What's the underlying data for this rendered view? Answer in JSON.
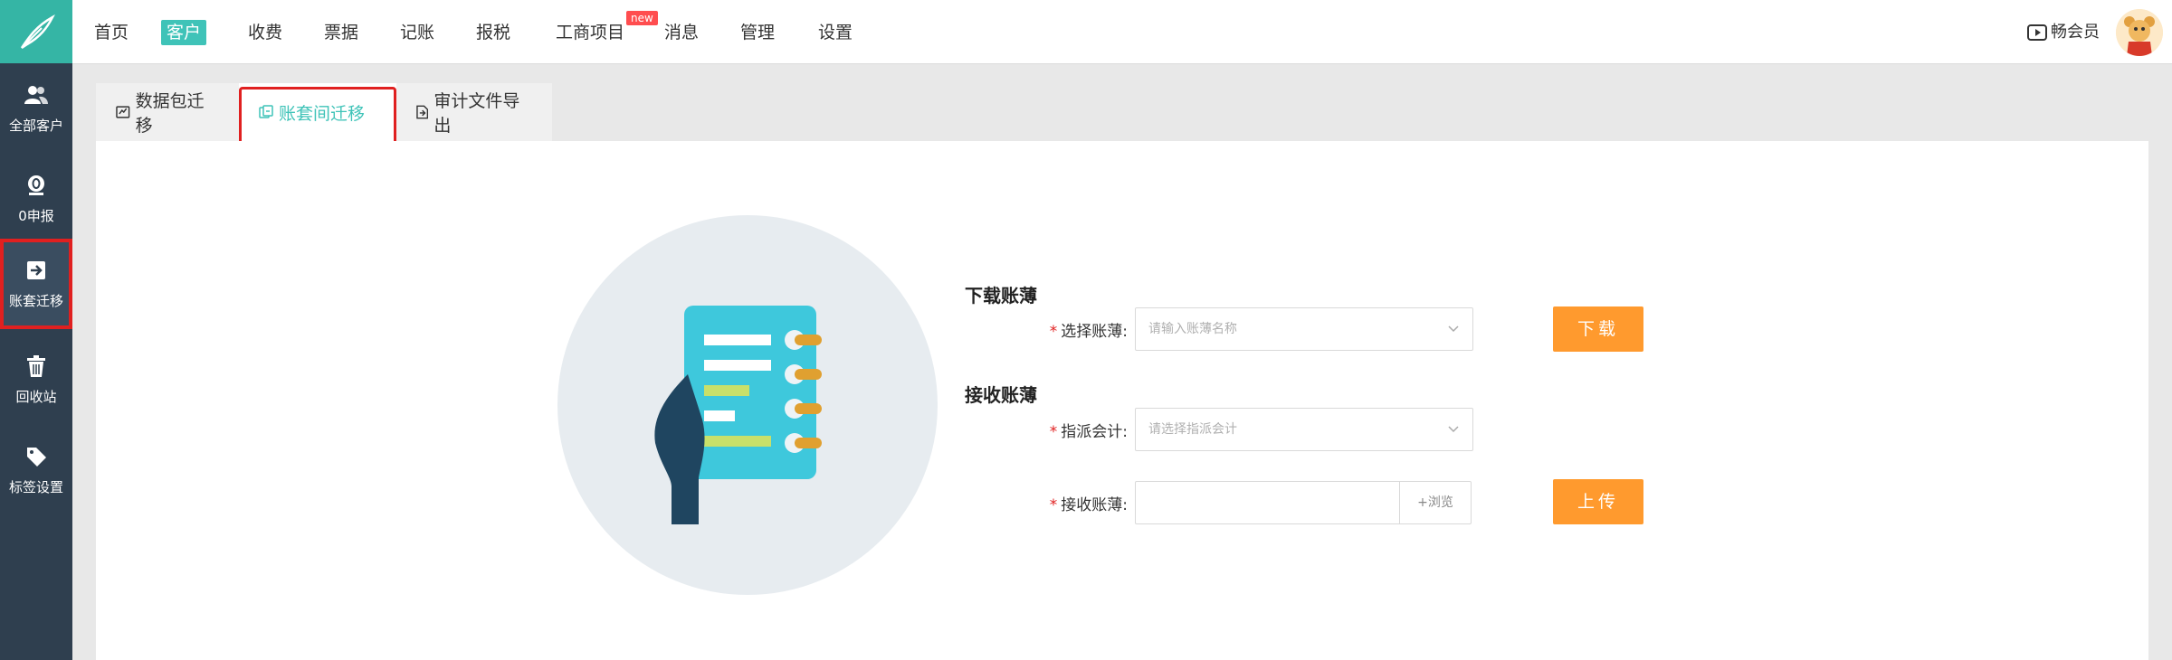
{
  "top_nav": {
    "items": [
      "首页",
      "客户",
      "收费",
      "票据",
      "记账",
      "报税",
      "工商项目",
      "消息",
      "管理",
      "设置"
    ],
    "active": "客户",
    "new_badge": "new",
    "member_label": "畅会员"
  },
  "sidebar": {
    "items": [
      {
        "label": "全部客户",
        "icon": "users-icon"
      },
      {
        "label": "0申报",
        "icon": "zero-declare-icon"
      },
      {
        "label": "账套迁移",
        "icon": "migrate-icon"
      },
      {
        "label": "回收站",
        "icon": "trash-icon"
      },
      {
        "label": "标签设置",
        "icon": "tag-icon"
      }
    ],
    "active": "账套迁移"
  },
  "tabs": [
    {
      "label": "数据包迁移",
      "icon": "package-icon"
    },
    {
      "label": "账套间迁移",
      "icon": "transfer-icon"
    },
    {
      "label": "审计文件导出",
      "icon": "file-export-icon"
    }
  ],
  "active_tab": "账套间迁移",
  "download": {
    "title": "下载账薄",
    "select_label": "选择账薄:",
    "select_placeholder": "请输入账薄名称",
    "button": "下载"
  },
  "receive": {
    "title": "接收账薄",
    "assign_label": "指派会计:",
    "assign_placeholder": "请选择指派会计",
    "file_label": "接收账薄:",
    "browse": "+浏览",
    "button": "上传"
  },
  "required_mark": "*",
  "colors": {
    "accent": "#3fc3b8",
    "sidebar_bg": "#2f3f4f",
    "button": "#ff9a2e",
    "required": "#e02020"
  }
}
